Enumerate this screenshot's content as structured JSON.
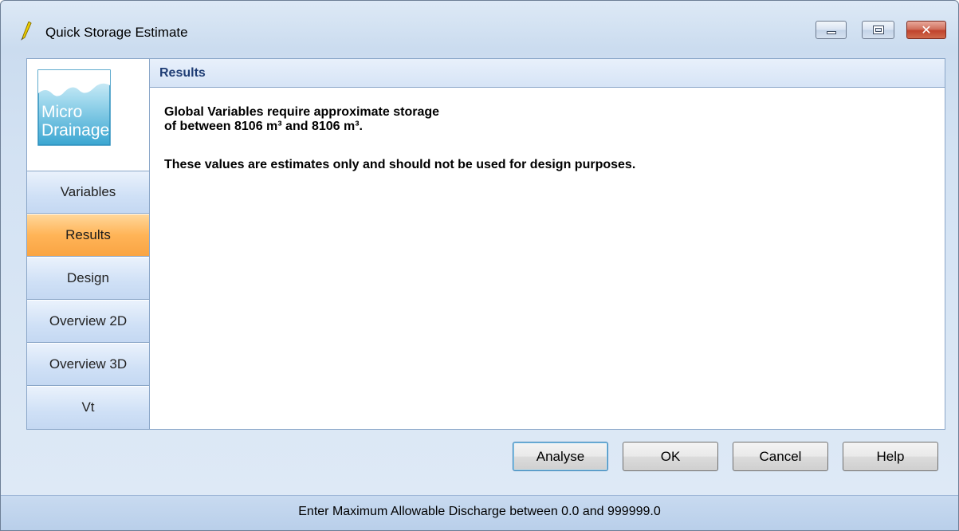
{
  "window": {
    "title": "Quick Storage Estimate",
    "icon": "lightning-pencil-icon",
    "controls": {
      "minimize": "minimize-icon",
      "maximize": "maximize-icon",
      "close": "✕"
    }
  },
  "logo": {
    "line1": "Micro",
    "line2": "Drainage"
  },
  "sidebar": {
    "items": [
      {
        "label": "Variables",
        "active": false
      },
      {
        "label": "Results",
        "active": true
      },
      {
        "label": "Design",
        "active": false
      },
      {
        "label": "Overview 2D",
        "active": false
      },
      {
        "label": "Overview 3D",
        "active": false
      },
      {
        "label": "Vt",
        "active": false
      }
    ]
  },
  "panel": {
    "header": "Results",
    "line1": "Global Variables require approximate storage",
    "line2": "of between 8106 m³ and 8106 m³.",
    "line3": "These values are estimates only and should not be used for design purposes."
  },
  "buttons": {
    "analyse": "Analyse",
    "ok": "OK",
    "cancel": "Cancel",
    "help": "Help"
  },
  "status": {
    "text": "Enter Maximum Allowable Discharge between 0.0 and 999999.0"
  },
  "colors": {
    "active_tab": "#ffb457",
    "header_text": "#1f3d74",
    "close_button": "#c0432d"
  }
}
